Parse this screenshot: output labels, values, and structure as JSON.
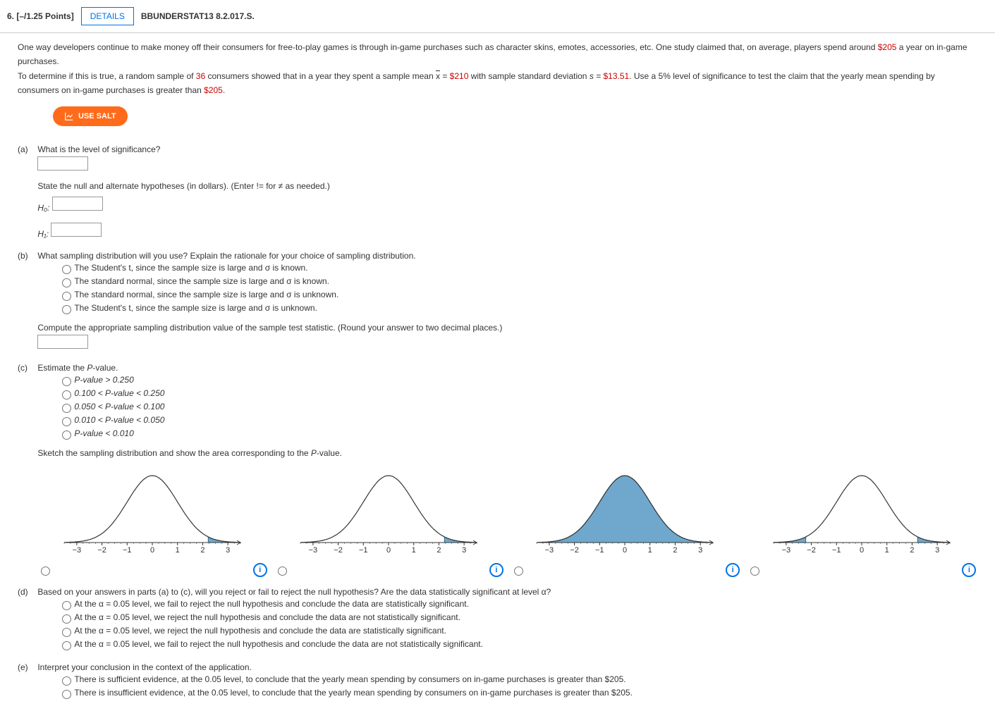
{
  "header": {
    "number": "6.",
    "points": "[–/1.25 Points]",
    "details_label": "DETAILS",
    "code": "BBUNDERSTAT13 8.2.017.S."
  },
  "description": {
    "line1_a": "One way developers continue to make money off their consumers for free-to-play games is through in-game purchases such as character skins, emotes, accessories, etc. One study claimed that, on average, players spend around ",
    "amount205": "$205",
    "line1_b": " a year on in-game purchases.",
    "line2_a": "To determine if this is true, a random sample of ",
    "n36": "36",
    "line2_b": " consumers showed that in a year they spent a sample mean ",
    "xeq": " = ",
    "amount210": "$210",
    "line2_c": " with sample standard deviation ",
    "seq": "s = ",
    "sd": "$13.51",
    "line2_d": ". Use a 5% level of significance to test the claim that the yearly mean spending by consumers on in-game purchases is greater than ",
    "line2_e": "."
  },
  "salt_label": "USE SALT",
  "part_a": {
    "label": "(a)",
    "q1": "What is the level of significance?",
    "q2": "State the null and alternate hypotheses (in dollars). (Enter != for ≠ as needed.)",
    "h0": "H₀:",
    "h1": "H₁:"
  },
  "part_b": {
    "label": "(b)",
    "q": "What sampling distribution will you use? Explain the rationale for your choice of sampling distribution.",
    "opt1": "The Student's t, since the sample size is large and σ is known.",
    "opt2": "The standard normal, since the sample size is large and σ is known.",
    "opt3": "The standard normal, since the sample size is large and σ is unknown.",
    "opt4": "The Student's t, since the sample size is large and σ is unknown.",
    "q2": "Compute the appropriate sampling distribution value of the sample test statistic. (Round your answer to two decimal places.)"
  },
  "part_c": {
    "label": "(c)",
    "q": "Estimate the P-value.",
    "opt1": "P-value > 0.250",
    "opt2": "0.100 < P-value < 0.250",
    "opt3": "0.050 < P-value < 0.100",
    "opt4": "0.010 < P-value < 0.050",
    "opt5": "P-value < 0.010",
    "q2": "Sketch the sampling distribution and show the area corresponding to the P-value."
  },
  "part_d": {
    "label": "(d)",
    "q": "Based on your answers in parts (a) to (c), will you reject or fail to reject the null hypothesis? Are the data statistically significant at level α?",
    "opt1": "At the α = 0.05 level, we fail to reject the null hypothesis and conclude the data are statistically significant.",
    "opt2": "At the α = 0.05 level, we reject the null hypothesis and conclude the data are not statistically significant.",
    "opt3": "At the α = 0.05 level, we reject the null hypothesis and conclude the data are statistically significant.",
    "opt4": "At the α = 0.05 level, we fail to reject the null hypothesis and conclude the data are not statistically significant."
  },
  "part_e": {
    "label": "(e)",
    "q": "Interpret your conclusion in the context of the application.",
    "opt1": "There is sufficient evidence, at the 0.05 level, to conclude that the yearly mean spending by consumers on in-game purchases is greater than $205.",
    "opt2": "There is insufficient evidence, at the 0.05 level, to conclude that the yearly mean spending by consumers on in-game purchases is greater than $205."
  },
  "chart_data": [
    {
      "type": "normal",
      "shade": "right-tail",
      "shade_from": 2.22,
      "xrange": [
        -3.5,
        3.5
      ],
      "ticks": [
        -3,
        -2,
        -1,
        0,
        1,
        2,
        3
      ]
    },
    {
      "type": "normal",
      "shade": "right-tail",
      "shade_from": 2.22,
      "xrange": [
        -3.5,
        3.5
      ],
      "ticks": [
        -3,
        -2,
        -1,
        0,
        1,
        2,
        3
      ]
    },
    {
      "type": "normal",
      "shade": "center-fill",
      "shade_from": -3,
      "shade_to": 3,
      "xrange": [
        -3.5,
        3.5
      ],
      "ticks": [
        -3,
        -2,
        -1,
        0,
        1,
        2,
        3
      ]
    },
    {
      "type": "normal",
      "shade": "two-tail",
      "shade_left": -2.22,
      "shade_right": 2.22,
      "xrange": [
        -3.5,
        3.5
      ],
      "ticks": [
        -3,
        -2,
        -1,
        0,
        1,
        2,
        3
      ]
    }
  ]
}
